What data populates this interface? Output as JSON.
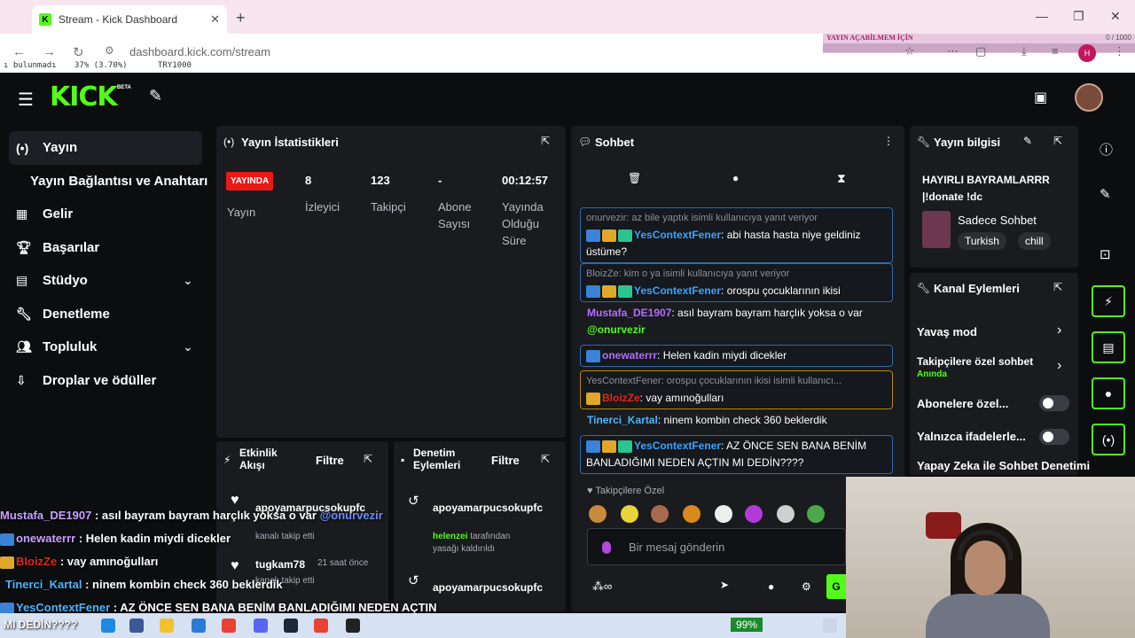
{
  "browser": {
    "tab_title": "Stream - Kick Dashboard",
    "url": "dashboard.kick.com/stream",
    "bookmarks": [
      "ı bulunmadı",
      "37% (3.70%)",
      "TRY1000"
    ],
    "overlay_title": "YAYIN AÇABİLMEM İÇİN",
    "overlay_progress": "0 / 1000",
    "overlay_fraction": 0.0,
    "profile_initial": "H"
  },
  "header": {
    "logo": "KICK",
    "beta": "BETA"
  },
  "sidebar": {
    "items": [
      {
        "label": "Yayın",
        "icon": "broadcast-icon"
      },
      {
        "label": "Yayın Bağlantısı ve Anahtarı",
        "icon": ""
      },
      {
        "label": "Gelir",
        "icon": "chart-icon"
      },
      {
        "label": "Başarılar",
        "icon": "trophy-icon"
      },
      {
        "label": "Stüdyo",
        "icon": "studio-icon"
      },
      {
        "label": "Denetleme",
        "icon": "wrench-icon"
      },
      {
        "label": "Topluluk",
        "icon": "community-icon"
      },
      {
        "label": "Droplar ve ödüller",
        "icon": "drops-icon"
      }
    ]
  },
  "stats": {
    "title": "Yayın İstatistikleri",
    "live_badge": "YAYINDA",
    "status_label": "Yayın",
    "viewers": "8",
    "viewers_label": "İzleyici",
    "followers": "123",
    "followers_label": "Takipçi",
    "subs": "-",
    "subs_label_1": "Abone",
    "subs_label_2": "Sayısı",
    "duration": "00:12:57",
    "duration_label_1": "Yayında",
    "duration_label_2": "Olduğu",
    "duration_label_3": "Süre"
  },
  "activity": {
    "title_1": "Etkinlik",
    "title_2": "Akışı",
    "filter": "Filtre",
    "items": [
      {
        "name": "apoyamarpucsokupfc",
        "sub": "kanalı takip etti"
      },
      {
        "name": "tugkam78",
        "time": "21 saat önce",
        "sub": "kanalı takip etti"
      }
    ]
  },
  "moderation": {
    "title_1": "Denetim",
    "title_2": "Eylemleri",
    "filter": "Filtre",
    "items": [
      {
        "name": "apoyamarpucsokupfc",
        "actor": "helenzei",
        "sub1": " tarafından",
        "sub2": "yasağı kaldırıldı"
      },
      {
        "name": "apoyamarpucsokupfc"
      }
    ]
  },
  "chat": {
    "title": "Sohbet",
    "messages": [
      {
        "reply": "onurvezir: az bile yaptık isimli kullanıcıya yanıt veriyor",
        "user": "YesContextFener",
        "text": ": abi hasta hasta niye geldiniz üstüme?"
      },
      {
        "reply": "BloizZe: kim o ya isimli kullanıcıya yanıt veriyor",
        "user": "YesContextFener",
        "text": ": orospu çocuklarının ikisi"
      },
      {
        "user": "Mustafa_DE1907",
        "text": ": asıl bayram bayram harçlık yoksa o var",
        "mention": "@onurvezir"
      },
      {
        "user": "onewaterrr",
        "text": ": Helen kadin miydi dicekler"
      },
      {
        "reply": "YesContextFener: orospu çocuklarının ikisi isimli kullanıcı...",
        "user": "BloizZe",
        "text": ": vay amınoğulları"
      },
      {
        "user": "Tinerci_Kartal",
        "text": ": ninem kombin check 360 beklerdik"
      },
      {
        "user": "YesContextFener",
        "text": ": AZ ÖNCE SEN BANA BENİM BANLADIĞIMI NEDEN AÇTIN MI DEDİN????"
      }
    ],
    "emote_label": "Takipçilere Özel",
    "input_placeholder": "Bir mesaj gönderin",
    "send_label": "G"
  },
  "stream_info": {
    "title": "Yayın bilgisi",
    "stream_title_1": "HAYIRLI BAYRAMLARRR",
    "stream_title_2": "|!donate !dc",
    "category": "Sadece Sohbet",
    "tags": [
      "Turkish",
      "chill"
    ]
  },
  "channel_actions": {
    "title": "Kanal Eylemleri",
    "slow_mode": "Yavaş mod",
    "followers_only": "Takipçilere özel sohbet",
    "followers_only_sub": "Anında",
    "subs_only": "Abonelere özel...",
    "emotes_only": "Yalnızca ifadelerle...",
    "ai_mod": "Yapay Zeka ile Sohbet Denetimi"
  },
  "overlay_chat": [
    {
      "user": "Mustafa_DE1907",
      "text": " : asıl bayram bayram harçlık yoksa o var ",
      "mention": "@onurvezir"
    },
    {
      "user": "onewaterrr",
      "text": " : Helen kadin miydi dicekler"
    },
    {
      "user": "BloizZe",
      "text": " : vay amınoğulları"
    },
    {
      "user": "Tinerci_Kartal",
      "text": " : ninem kombin check 360 beklerdik"
    },
    {
      "user": "YesContextFener",
      "text": " : AZ ÖNCE SEN BANA BENİM BANLADIĞIMI NEDEN AÇTIN"
    },
    {
      "user": "",
      "text": "MI DEDİN????"
    }
  ],
  "taskbar": {
    "battery": "99%"
  },
  "colors": {
    "brand": "#53fc18",
    "live": "#e91916",
    "panel": "#191b1f"
  }
}
